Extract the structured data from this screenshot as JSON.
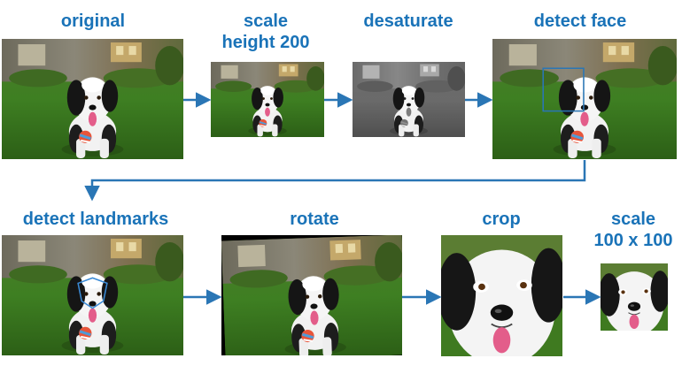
{
  "stages": [
    {
      "id": "original",
      "label": "original"
    },
    {
      "id": "scale-height",
      "label_line1": "scale",
      "label_line2": "height 200"
    },
    {
      "id": "desaturate",
      "label": "desaturate"
    },
    {
      "id": "detect-face",
      "label": "detect face"
    },
    {
      "id": "detect-landmarks",
      "label": "detect landmarks"
    },
    {
      "id": "rotate",
      "label": "rotate"
    },
    {
      "id": "crop",
      "label": "crop"
    },
    {
      "id": "scale-square",
      "label_line1": "scale",
      "label_line2": "100 x 100"
    }
  ],
  "colors": {
    "accent": "#1a73b8",
    "arrow": "#2a76b5",
    "label": "#1a73b8"
  }
}
